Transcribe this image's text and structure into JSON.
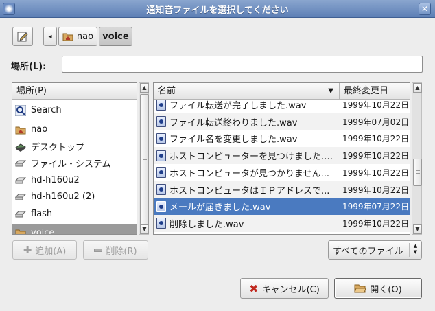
{
  "window": {
    "title": "通知音ファイルを選択してください",
    "close_glyph": "✕"
  },
  "path_bar": {
    "segments": [
      "nao",
      "voice"
    ],
    "back_glyph": "◂"
  },
  "location": {
    "label": "場所(L):",
    "value": ""
  },
  "places": {
    "header": "場所(P)",
    "items": [
      {
        "label": "Search",
        "icon": "search-icon"
      },
      {
        "label": "nao",
        "icon": "home-folder-icon"
      },
      {
        "label": "デスクトップ",
        "icon": "desktop-icon"
      },
      {
        "label": "ファイル・システム",
        "icon": "drive-icon"
      },
      {
        "label": "hd-h160u2",
        "icon": "drive-icon"
      },
      {
        "label": "hd-h160u2 (2)",
        "icon": "drive-icon"
      },
      {
        "label": "flash",
        "icon": "drive-icon"
      },
      {
        "label": "voice",
        "icon": "folder-icon"
      }
    ],
    "add_button": "追加(A)",
    "remove_button": "削除(R)"
  },
  "files": {
    "col_name": "名前",
    "col_modified": "最終変更日",
    "rows": [
      {
        "name": "ファイル転送が完了しました.wav",
        "date": "1999年10月22日"
      },
      {
        "name": "ファイル転送終わりました.wav",
        "date": "1999年07月02日"
      },
      {
        "name": "ファイル名を変更しました.wav",
        "date": "1999年10月22日"
      },
      {
        "name": "ホストコンピューターを見つけました.…",
        "date": "1999年10月22日"
      },
      {
        "name": "ホストコンピュータが見つかりません...",
        "date": "1999年10月22日"
      },
      {
        "name": "ホストコンピュータはＩＰアドレスで...",
        "date": "1999年10月22日"
      },
      {
        "name": "メールが届きました.wav",
        "date": "1999年07月22日"
      },
      {
        "name": "削除しました.wav",
        "date": "1999年10月22日"
      }
    ],
    "selected_index": 6
  },
  "filter": {
    "value": "すべてのファイル"
  },
  "buttons": {
    "cancel": "キャンセル(C)",
    "open": "開く(O)"
  }
}
